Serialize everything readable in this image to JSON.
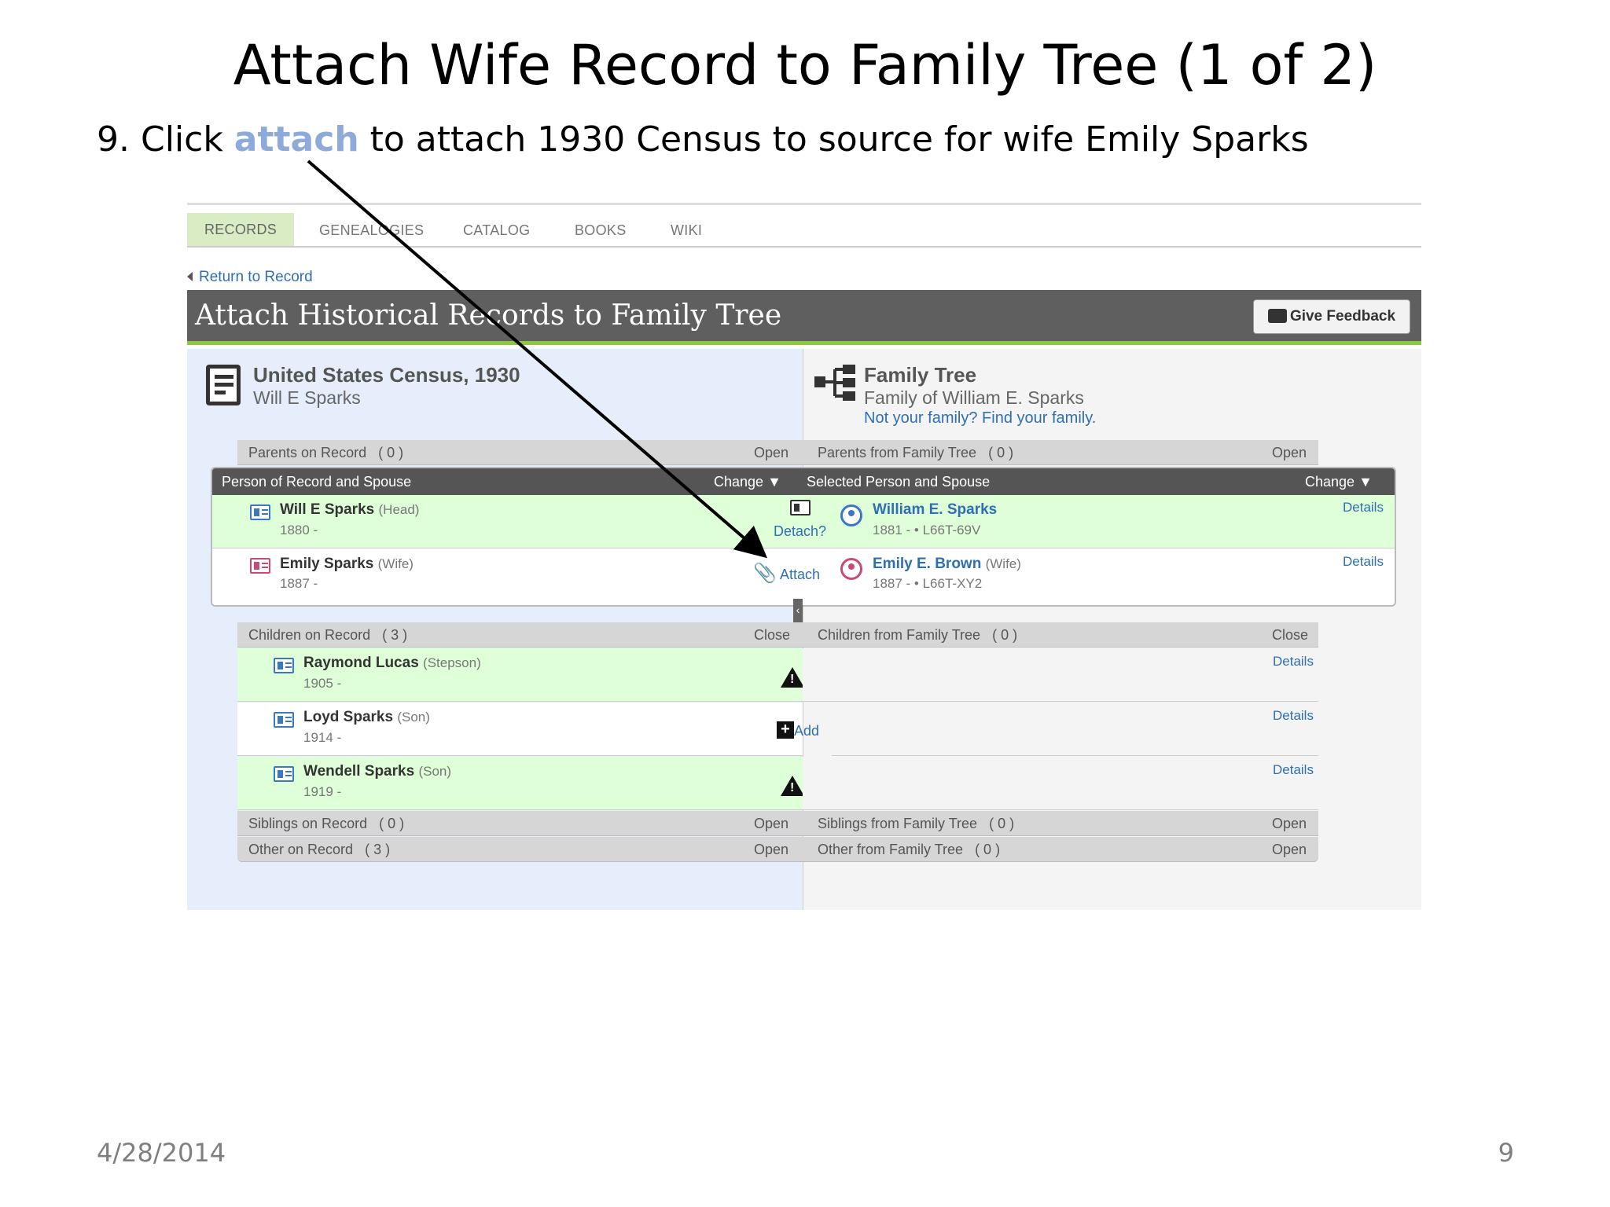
{
  "slide": {
    "title": "Attach Wife Record to Family Tree (1 of 2)",
    "instruction_prefix": "9. Click ",
    "instruction_keyword": "attach",
    "instruction_suffix": " to attach 1930 Census to source for wife Emily Sparks",
    "date": "4/28/2014",
    "page_number": "9"
  },
  "nav": {
    "tabs": [
      "RECORDS",
      "GENEALOGIES",
      "CATALOG",
      "BOOKS",
      "WIKI"
    ],
    "active": "RECORDS",
    "return_link": "Return to Record"
  },
  "header": {
    "title": "Attach Historical Records to Family Tree",
    "feedback_button": "Give Feedback"
  },
  "source": {
    "title": "United States Census, 1930",
    "subtitle": "Will E Sparks"
  },
  "tree": {
    "title": "Family Tree",
    "subtitle": "Family of William E. Sparks",
    "link": "Not your family? Find your family."
  },
  "sections": {
    "parents_left": "Parents on Record",
    "parents_left_count": "( 0 )",
    "parents_left_action": "Open",
    "parents_right": "Parents from Family Tree",
    "parents_right_count": "( 0 )",
    "parents_right_action": "Open",
    "person_left": "Person of Record and Spouse",
    "person_left_action": "Change",
    "person_right": "Selected Person and Spouse",
    "person_right_action": "Change",
    "children_left": "Children on Record",
    "children_left_count": "( 3 )",
    "children_left_action": "Close",
    "children_right": "Children from Family Tree",
    "children_right_count": "( 0 )",
    "children_right_action": "Close",
    "siblings_left": "Siblings on Record",
    "siblings_left_count": "( 0 )",
    "siblings_left_action": "Open",
    "siblings_right": "Siblings from Family Tree",
    "siblings_right_count": "( 0 )",
    "siblings_right_action": "Open",
    "other_left": "Other on Record",
    "other_left_count": "( 3 )",
    "other_left_action": "Open",
    "other_right": "Other from Family Tree",
    "other_right_count": "( 0 )",
    "other_right_action": "Open"
  },
  "record_people": [
    {
      "name": "Will E Sparks",
      "role": "(Head)",
      "years": "1880 -"
    },
    {
      "name": "Emily Sparks",
      "role": "(Wife)",
      "years": "1887 -"
    }
  ],
  "tree_people": [
    {
      "name": "William E. Sparks",
      "role": "",
      "years": "1881 - • L66T-69V"
    },
    {
      "name": "Emily E. Brown",
      "role": "(Wife)",
      "years": "1887 - • L66T-XY2"
    }
  ],
  "actions": {
    "detach": "Detach?",
    "attach": "Attach",
    "add": "Add",
    "details": "Details"
  },
  "children": [
    {
      "name": "Raymond Lucas",
      "role": "(Stepson)",
      "years": "1905 -"
    },
    {
      "name": "Loyd Sparks",
      "role": "(Son)",
      "years": "1914 -"
    },
    {
      "name": "Wendell Sparks",
      "role": "(Son)",
      "years": "1919 -"
    }
  ],
  "colors": {
    "accent_blue": "#2f6fb3",
    "match_green": "#dfffd8",
    "header_grey": "#5f5f5f",
    "keyword_blue": "#8eaadb"
  }
}
